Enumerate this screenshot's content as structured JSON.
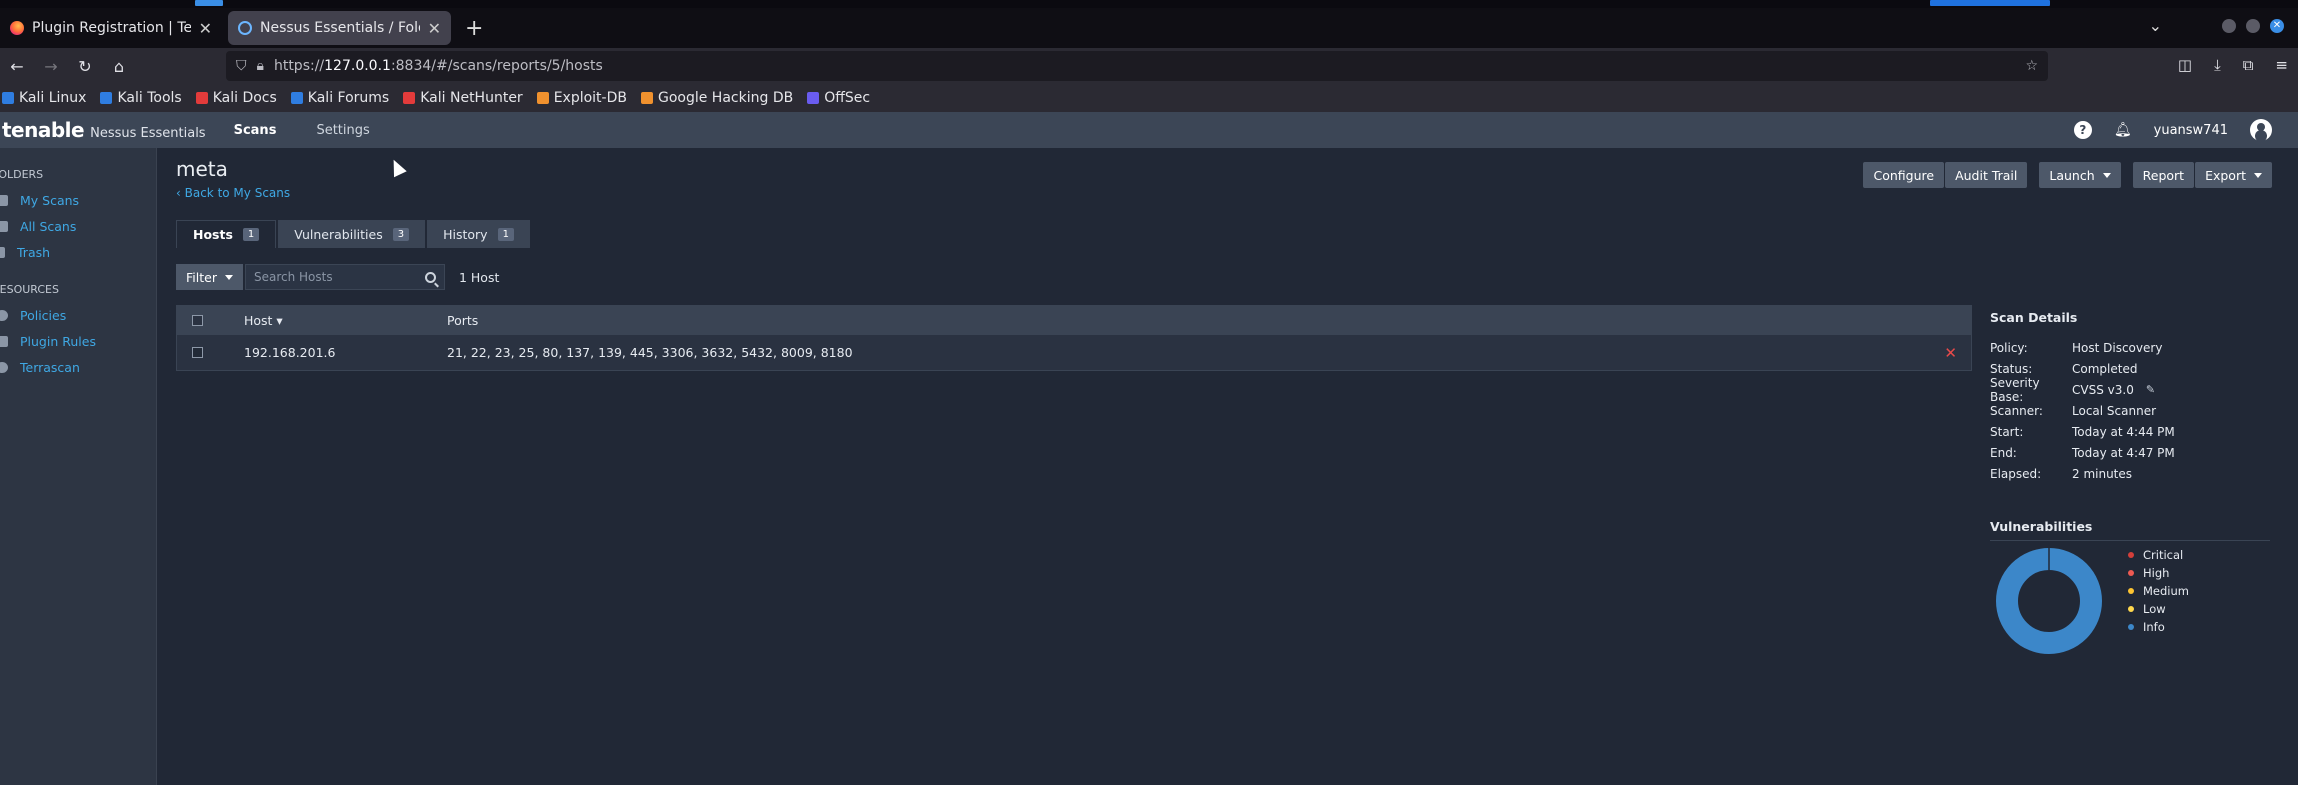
{
  "browser": {
    "tabs": [
      {
        "label": "Plugin Registration | Tenable",
        "active": false
      },
      {
        "label": "Nessus Essentials / Folde",
        "active": true
      }
    ],
    "url_prefix": "https://",
    "url_host": "127.0.0.1",
    "url_rest": ":8834/#/scans/reports/5/hosts",
    "bookmarks": [
      {
        "label": "Kali Linux",
        "color": "#2f7de1"
      },
      {
        "label": "Kali Tools",
        "color": "#2f7de1"
      },
      {
        "label": "Kali Docs",
        "color": "#e33b3b"
      },
      {
        "label": "Kali Forums",
        "color": "#2f7de1"
      },
      {
        "label": "Kali NetHunter",
        "color": "#e33b3b"
      },
      {
        "label": "Exploit-DB",
        "color": "#f0912e"
      },
      {
        "label": "Google Hacking DB",
        "color": "#f0912e"
      },
      {
        "label": "OffSec",
        "color": "#6a5cf0"
      }
    ]
  },
  "app": {
    "brand": "tenable",
    "product": "Nessus Essentials",
    "nav": [
      "Scans",
      "Settings"
    ],
    "username": "yuansw741"
  },
  "sidebar": {
    "folders_heading": "FOLDERS",
    "folders": [
      "My Scans",
      "All Scans",
      "Trash"
    ],
    "resources_heading": "RESOURCES",
    "resources": [
      "Policies",
      "Plugin Rules",
      "Terrascan"
    ]
  },
  "scan": {
    "title": "meta",
    "back_label": "Back to My Scans",
    "actions": {
      "configure": "Configure",
      "audit_trail": "Audit Trail",
      "launch": "Launch",
      "report": "Report",
      "export": "Export"
    },
    "tabs": [
      {
        "label": "Hosts",
        "count": "1"
      },
      {
        "label": "Vulnerabilities",
        "count": "3"
      },
      {
        "label": "History",
        "count": "1"
      }
    ],
    "filter_label": "Filter",
    "search_placeholder": "Search Hosts",
    "host_count": "1 Host",
    "table": {
      "headers": {
        "host": "Host ▾",
        "ports": "Ports"
      },
      "rows": [
        {
          "host": "192.168.201.6",
          "ports": "21, 22, 23, 25, 80, 137, 139, 445, 3306, 3632, 5432, 8009, 8180"
        }
      ]
    }
  },
  "details": {
    "heading": "Scan Details",
    "items": [
      {
        "k": "Policy:",
        "v": "Host Discovery"
      },
      {
        "k": "Status:",
        "v": "Completed"
      },
      {
        "k": "Severity Base:",
        "v": "CVSS v3.0"
      },
      {
        "k": "Scanner:",
        "v": "Local Scanner"
      },
      {
        "k": "Start:",
        "v": "Today at 4:44 PM"
      },
      {
        "k": "End:",
        "v": "Today at 4:47 PM"
      },
      {
        "k": "Elapsed:",
        "v": "2 minutes"
      }
    ]
  },
  "vulnerabilities": {
    "heading": "Vulnerabilities",
    "legend": [
      {
        "label": "Critical",
        "color": "#d43f3a"
      },
      {
        "label": "High",
        "color": "#ee5a52"
      },
      {
        "label": "Medium",
        "color": "#fdc431"
      },
      {
        "label": "Low",
        "color": "#ffd84d"
      },
      {
        "label": "Info",
        "color": "#3c87c9"
      }
    ]
  }
}
